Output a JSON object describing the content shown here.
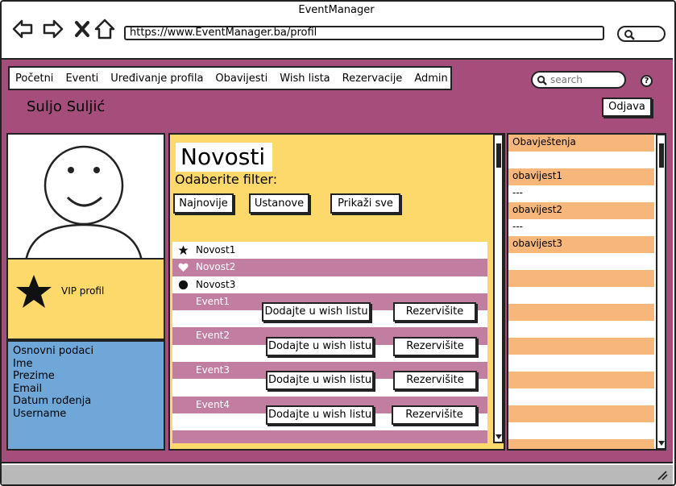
{
  "window": {
    "title": "EventManager"
  },
  "browser": {
    "url": "https://www.EventManager.ba/profil"
  },
  "menu": {
    "items": [
      "Početni",
      "Eventi",
      "Uređivanje profila",
      "Obavijesti",
      "Wish lista",
      "Rezervacije",
      "Admin"
    ]
  },
  "search": {
    "placeholder": "search"
  },
  "help": {
    "label": "?"
  },
  "user": {
    "name": "Suljo Suljić",
    "logout_label": "Odjava"
  },
  "profile": {
    "vip_label": "VIP profil",
    "info": [
      "Osnovni podaci",
      "Ime",
      "Prezime",
      "Email",
      "Datum rođenja",
      "Username"
    ]
  },
  "news": {
    "title": "Novosti",
    "filter_label": "Odaberite filter:",
    "filters": [
      "Najnovije",
      "Ustanove",
      "Prikaži sve"
    ],
    "items": [
      {
        "label": "Novost1",
        "icon": "star-icon"
      },
      {
        "label": "Novost2",
        "icon": "heart-icon"
      },
      {
        "label": "Novost3",
        "icon": "circle-icon"
      }
    ],
    "events": [
      "Event1",
      "Event2",
      "Event3",
      "Event4"
    ],
    "wish_label": "Dodajte u wish listu",
    "reserve_label": "Rezervišite"
  },
  "notifications": {
    "header": "Obavještenja",
    "items": [
      "obavijest1",
      "---",
      "obavijest2",
      "---",
      "obavijest3"
    ]
  },
  "colors": {
    "main_bg": "#a54e7c",
    "yellow": "#fdd86b",
    "blue": "#70a7d9",
    "pink_row": "#c27ea0",
    "orange_stripe": "#f8b77a",
    "status_bar": "#b9b9b9"
  }
}
